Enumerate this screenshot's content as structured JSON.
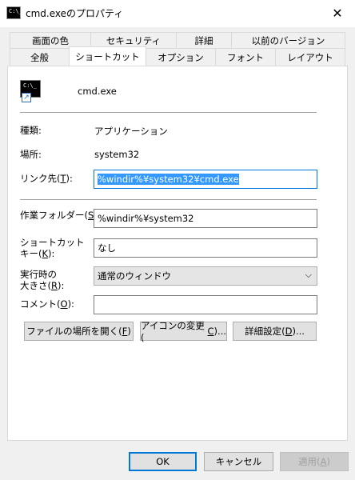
{
  "window": {
    "title": "cmd.exeのプロパティ",
    "icon_text": "C:\\_",
    "close_glyph": "✕"
  },
  "tabs_row1": [
    "画面の色",
    "セキュリティ",
    "詳細",
    "以前のバージョン"
  ],
  "tabs_row2": [
    "全般",
    "ショートカット",
    "オプション",
    "フォント",
    "レイアウト"
  ],
  "active_tab": "ショートカット",
  "icon_label": "cmd.exe",
  "fields": {
    "type_label": "種類:",
    "type_value": "アプリケーション",
    "location_label": "場所:",
    "location_value": "system32",
    "target_label_pre": "リンク先(",
    "target_label_key": "T",
    "target_label_post": "):",
    "target_value": "%windir%¥system32¥cmd.exe",
    "workdir_label_pre": "作業フォルダー(",
    "workdir_label_key": "S",
    "workdir_label_post": "):",
    "workdir_value": "%windir%¥system32",
    "shortcutkey_label_line1": "ショートカット",
    "shortcutkey_label_pre": "キー(",
    "shortcutkey_label_key": "K",
    "shortcutkey_label_post": "):",
    "shortcutkey_value": "なし",
    "run_label_line1": "実行時の",
    "run_label_pre": "大きさ(",
    "run_label_key": "R",
    "run_label_post": "):",
    "run_value": "通常のウィンドウ",
    "comment_label_pre": "コメント(",
    "comment_label_key": "O",
    "comment_label_post": "):",
    "comment_value": ""
  },
  "action_buttons": {
    "open_location_pre": "ファイルの場所を開く(",
    "open_location_key": "F",
    "open_location_post": ")",
    "change_icon_pre": "アイコンの変更(",
    "change_icon_key": "C",
    "change_icon_post": ")...",
    "advanced_pre": "詳細設定(",
    "advanced_key": "D",
    "advanced_post": ")..."
  },
  "footer": {
    "ok": "OK",
    "cancel": "キャンセル",
    "apply_pre": "適用(",
    "apply_key": "A",
    "apply_post": ")"
  }
}
